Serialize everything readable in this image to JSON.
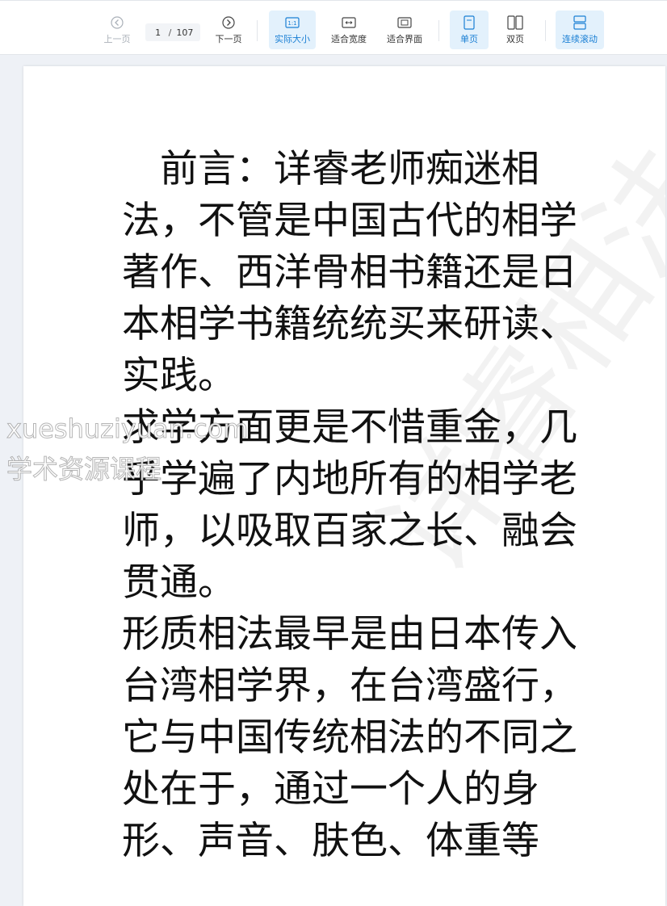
{
  "toolbar": {
    "prev_label": "上一页",
    "next_label": "下一页",
    "page_current": "1",
    "page_separator": "/",
    "page_total": "107",
    "actual_size_label": "实际大小",
    "fit_width_label": "适合宽度",
    "fit_page_label": "适合界面",
    "single_page_label": "单页",
    "double_page_label": "双页",
    "continuous_label": "连续滚动"
  },
  "document": {
    "paragraphs": [
      "前言：详睿老师痴迷相法，不管是中国古代的相学著作、西洋骨相书籍还是日本相学书籍统统买来研读、实践。",
      "求学方面更是不惜重金，几乎学遍了内地所有的相学老师，以吸取百家之长、融会贯通。",
      "形质相法最早是由日本传入台湾相学界，在台湾盛行，它与中国传统相法的不同之处在于，通过一个人的身形、声音、肤色、体重等"
    ]
  },
  "watermarks": {
    "site": "xueshuziyuan.com",
    "site_cn": "学术资源课程",
    "faint": "详睿相法"
  },
  "colors": {
    "accent": "#1a7fd4",
    "active_bg": "#e3f1fc",
    "page_bg": "#eef1f6"
  }
}
